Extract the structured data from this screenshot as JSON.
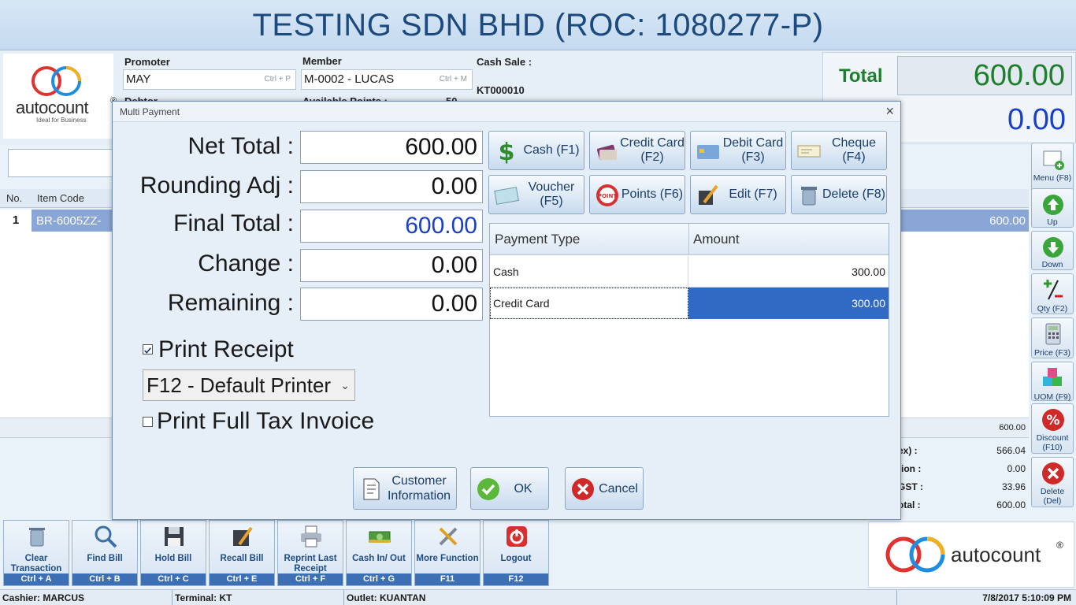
{
  "app": {
    "title": "TESTING SDN BHD (ROC: 1080277-P)"
  },
  "logo": {
    "text": "autocount",
    "registered": "®",
    "tagline": "Ideal for Business"
  },
  "header": {
    "promoter_label": "Promoter",
    "promoter_value": "MAY",
    "promoter_hint": "Ctrl + P",
    "member_label": "Member",
    "member_value": "M-0002 - LUCAS",
    "member_hint": "Ctrl + M",
    "cash_sale_label": "Cash Sale :",
    "doc_no": "KT000010",
    "debtor_label": "Debtor",
    "avail_points_label": "Available Points :",
    "avail_points_value": "50"
  },
  "totals": {
    "total_label": "Total",
    "total_value": "600.00",
    "secondary_value": "0.00"
  },
  "grid": {
    "columns": [
      "No.",
      "Item Code"
    ],
    "rows": [
      {
        "no": "1",
        "code": "BR-6005ZZ-",
        "amount": "600.00"
      }
    ],
    "footer_total": "600.00"
  },
  "summary": [
    {
      "label": "ex) :",
      "value": "566.04"
    },
    {
      "label": "tion :",
      "value": "0.00"
    },
    {
      "label": "GST :",
      "value": "33.96"
    },
    {
      "label": "otal :",
      "value": "600.00"
    }
  ],
  "side_buttons": [
    {
      "label": "Menu (F8)",
      "icon": "menu-add-icon"
    },
    {
      "label": "Up",
      "icon": "arrow-up-icon"
    },
    {
      "label": "Down",
      "icon": "arrow-down-icon"
    },
    {
      "label": "Qty (F2)",
      "icon": "plus-minus-icon"
    },
    {
      "label": "Price (F3)",
      "icon": "calculator-icon"
    },
    {
      "label": "UOM (F9)",
      "icon": "boxes-icon"
    },
    {
      "label": "Discount (F10)",
      "icon": "percent-icon"
    },
    {
      "label": "Delete (Del)",
      "icon": "delete-x-icon"
    }
  ],
  "toolbar": [
    {
      "label": "Clear Transaction",
      "key": "Ctrl + A",
      "icon": "trash-icon"
    },
    {
      "label": "Find Bill",
      "key": "Ctrl + B",
      "icon": "magnifier-icon"
    },
    {
      "label": "Hold Bill",
      "key": "Ctrl + C",
      "icon": "floppy-icon"
    },
    {
      "label": "Recall Bill",
      "key": "Ctrl + E",
      "icon": "recall-pencil-icon"
    },
    {
      "label": "Reprint Last Receipt",
      "key": "Ctrl + F",
      "icon": "printer-icon"
    },
    {
      "label": "Cash In/ Out",
      "key": "Ctrl + G",
      "icon": "cash-stack-icon"
    },
    {
      "label": "More Function",
      "key": "F11",
      "icon": "tools-icon"
    },
    {
      "label": "Logout",
      "key": "F12",
      "icon": "logout-icon"
    }
  ],
  "status": {
    "cashier": "Cashier: MARCUS",
    "terminal": "Terminal: KT",
    "outlet": "Outlet: KUANTAN",
    "datetime": "7/8/2017 5:10:09 PM"
  },
  "dialog": {
    "title": "Multi Payment",
    "close": "×",
    "fields": [
      {
        "label": "Net Total :",
        "value": "600.00"
      },
      {
        "label": "Rounding Adj :",
        "value": "0.00"
      },
      {
        "label": "Final Total :",
        "value": "600.00"
      },
      {
        "label": "Change :",
        "value": "0.00"
      },
      {
        "label": "Remaining :",
        "value": "0.00"
      }
    ],
    "pay_buttons": [
      {
        "label": "Cash (F1)",
        "icon": "dollar-icon"
      },
      {
        "label": "Credit Card (F2)",
        "icon": "credit-card-icon"
      },
      {
        "label": "Debit Card (F3)",
        "icon": "debit-card-icon"
      },
      {
        "label": "Cheque (F4)",
        "icon": "cheque-icon"
      },
      {
        "label": "Voucher (F5)",
        "icon": "voucher-icon"
      },
      {
        "label": "Points (F6)",
        "icon": "points-icon"
      },
      {
        "label": "Edit (F7)",
        "icon": "edit-icon"
      },
      {
        "label": "Delete (F8)",
        "icon": "delete-bin-icon"
      }
    ],
    "payment_grid": {
      "col_type": "Payment Type",
      "col_amount": "Amount",
      "rows": [
        {
          "type": "Cash",
          "amount": "300.00"
        },
        {
          "type": "Credit Card",
          "amount": "300.00"
        }
      ]
    },
    "print_receipt": "Print Receipt",
    "printer": "F12 - Default Printer",
    "print_full_tax": "Print Full Tax Invoice",
    "btn_customer": "Customer Information",
    "btn_ok": "OK",
    "btn_cancel": "Cancel",
    "colors": {
      "final_total": "#1a3fc8",
      "selected_row": "#316ac5"
    }
  }
}
